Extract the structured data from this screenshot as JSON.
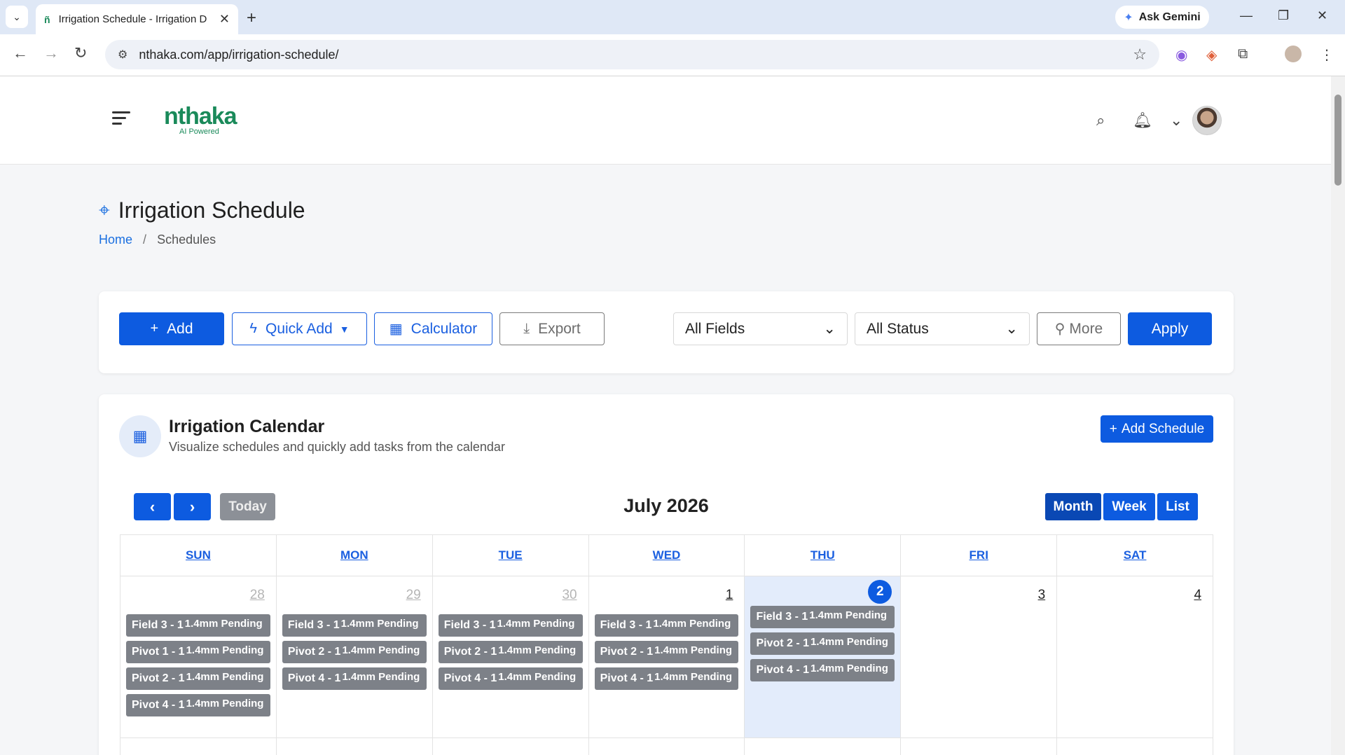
{
  "browser": {
    "tab_title": "Irrigation Schedule - Irrigation D",
    "url": "nthaka.com/app/irrigation-schedule/",
    "ask_gemini": "Ask Gemini"
  },
  "app": {
    "logo_text": "nthaka",
    "logo_sub": "AI Powered"
  },
  "page": {
    "title": "Irrigation Schedule",
    "breadcrumb": {
      "home": "Home",
      "current": "Schedules"
    }
  },
  "toolbar": {
    "add": "Add",
    "quick_add": "Quick Add",
    "calculator": "Calculator",
    "export": "Export",
    "fields_select": "All Fields",
    "status_select": "All Status",
    "more": "More",
    "apply": "Apply"
  },
  "calendar": {
    "title": "Irrigation Calendar",
    "subtitle": "Visualize schedules and quickly add tasks from the calendar",
    "add_schedule": "Add Schedule",
    "today": "Today",
    "month_title": "July 2026",
    "views": {
      "month": "Month",
      "week": "Week",
      "list": "List"
    },
    "days_of_week": [
      "SUN",
      "MON",
      "TUE",
      "WED",
      "THU",
      "FRI",
      "SAT"
    ],
    "week1": [
      {
        "num": "28",
        "other": true,
        "events": [
          [
            "Field 3 - 1",
            "1.4mm Pending"
          ],
          [
            "Pivot 1 - 1",
            "1.4mm Pending"
          ],
          [
            "Pivot 2 - 1",
            "1.4mm Pending"
          ],
          [
            "Pivot 4 - 1",
            "1.4mm Pending"
          ]
        ]
      },
      {
        "num": "29",
        "other": true,
        "events": [
          [
            "Field 3 - 1",
            "1.4mm Pending"
          ],
          [
            "Pivot 2 - 1",
            "1.4mm Pending"
          ],
          [
            "Pivot 4 - 1",
            "1.4mm Pending"
          ]
        ]
      },
      {
        "num": "30",
        "other": true,
        "events": [
          [
            "Field 3 - 1",
            "1.4mm Pending"
          ],
          [
            "Pivot 2 - 1",
            "1.4mm Pending"
          ],
          [
            "Pivot 4 - 1",
            "1.4mm Pending"
          ]
        ]
      },
      {
        "num": "1",
        "events": [
          [
            "Field 3 - 1",
            "1.4mm Pending"
          ],
          [
            "Pivot 2 - 1",
            "1.4mm Pending"
          ],
          [
            "Pivot 4 - 1",
            "1.4mm Pending"
          ]
        ]
      },
      {
        "num": "2",
        "today": true,
        "events": [
          [
            "Field 3 - 1",
            "1.4mm Pending"
          ],
          [
            "Pivot 2 - 1",
            "1.4mm Pending"
          ],
          [
            "Pivot 4 - 1",
            "1.4mm Pending"
          ]
        ]
      },
      {
        "num": "3",
        "events": []
      },
      {
        "num": "4",
        "events": []
      }
    ]
  }
}
